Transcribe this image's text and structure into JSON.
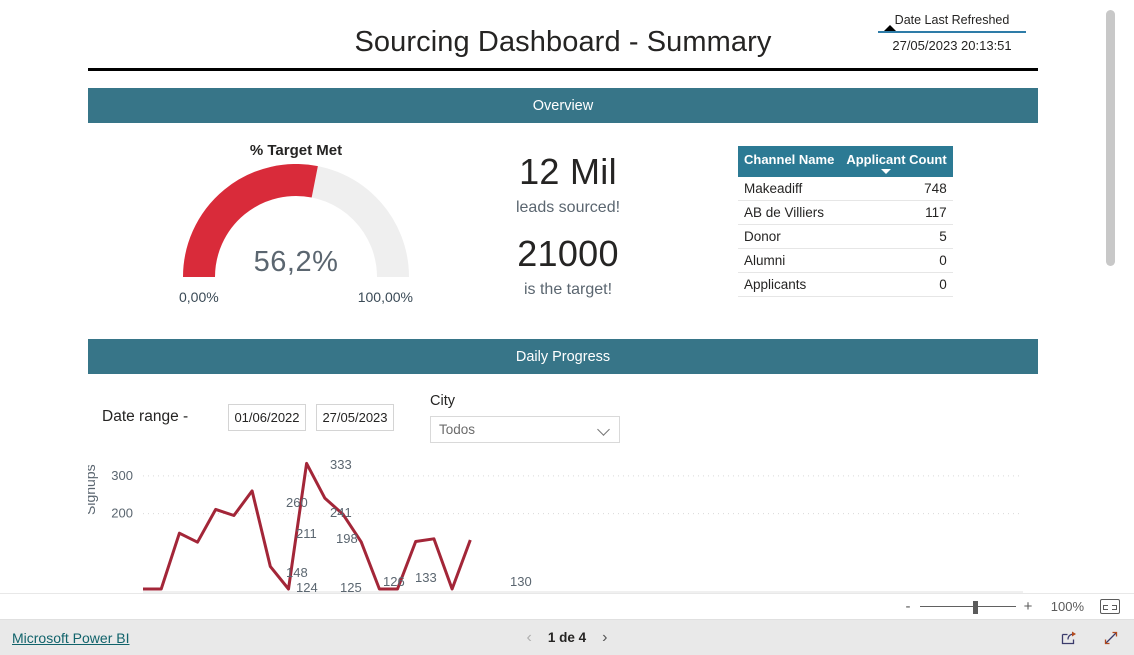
{
  "header": {
    "title": "Sourcing Dashboard - Summary",
    "refresh_label": "Date Last Refreshed",
    "refresh_value": "27/05/2023 20:13:51"
  },
  "sections": {
    "overview_banner": "Overview",
    "daily_banner": "Daily Progress"
  },
  "gauge": {
    "title": "% Target Met",
    "value_label": "56,2%",
    "min_label": "0,00%",
    "max_label": "100,00%",
    "percent": 56.2,
    "fill_color": "#d92b3a",
    "track_color": "#efefef"
  },
  "kpi": {
    "leads_value": "12 Mil",
    "leads_caption": "leads sourced!",
    "target_value": "21000",
    "target_caption": "is the target!"
  },
  "channel_table": {
    "columns": [
      "Channel Name",
      "Applicant Count"
    ],
    "sorted_column": "Applicant Count",
    "sort_direction": "descending",
    "header_bg": "#2c7a94",
    "rows": [
      {
        "channel": "Makeadiff",
        "count": "748"
      },
      {
        "channel": "AB de Villiers",
        "count": "117"
      },
      {
        "channel": "Donor",
        "count": "5"
      },
      {
        "channel": "Alumni",
        "count": "0"
      },
      {
        "channel": "Applicants",
        "count": "0"
      }
    ]
  },
  "filters": {
    "date_range_label": "Date range -",
    "date_from": "01/06/2022",
    "date_to": "27/05/2023",
    "city_label": "City",
    "city_value": "Todos",
    "city_chevron": "chevron-down-icon"
  },
  "chart_data": {
    "type": "line",
    "title": "",
    "xlabel": "",
    "ylabel": "Signups",
    "ylim": [
      0,
      350
    ],
    "yticks": [
      200,
      300
    ],
    "ytick_labels": [
      "200",
      "300"
    ],
    "grid": true,
    "legend": false,
    "line_color": "#a32638",
    "labels": [
      "148",
      "124",
      "211",
      "260",
      "333",
      "241",
      "198",
      "125",
      "126",
      "133",
      "130"
    ],
    "series": [
      {
        "name": "Signups",
        "x": [
          0,
          1,
          2,
          3,
          4,
          5,
          6,
          7,
          8,
          9,
          10,
          11,
          12,
          13,
          14,
          15,
          16,
          17,
          18
        ],
        "values": [
          0,
          0,
          148,
          124,
          211,
          195,
          260,
          60,
          0,
          333,
          241,
          198,
          125,
          0,
          0,
          126,
          133,
          0,
          130
        ]
      }
    ]
  },
  "zoombar": {
    "minus": "-",
    "plus": "+",
    "percent": "100%",
    "fit_icon": "fit-to-page-icon"
  },
  "footer": {
    "brand": "Microsoft Power BI",
    "prev_icon": "chevron-left-icon",
    "next_icon": "chevron-right-icon",
    "page_label": "1 de 4",
    "share_icon": "share-icon",
    "fullscreen_icon": "fullscreen-icon"
  }
}
